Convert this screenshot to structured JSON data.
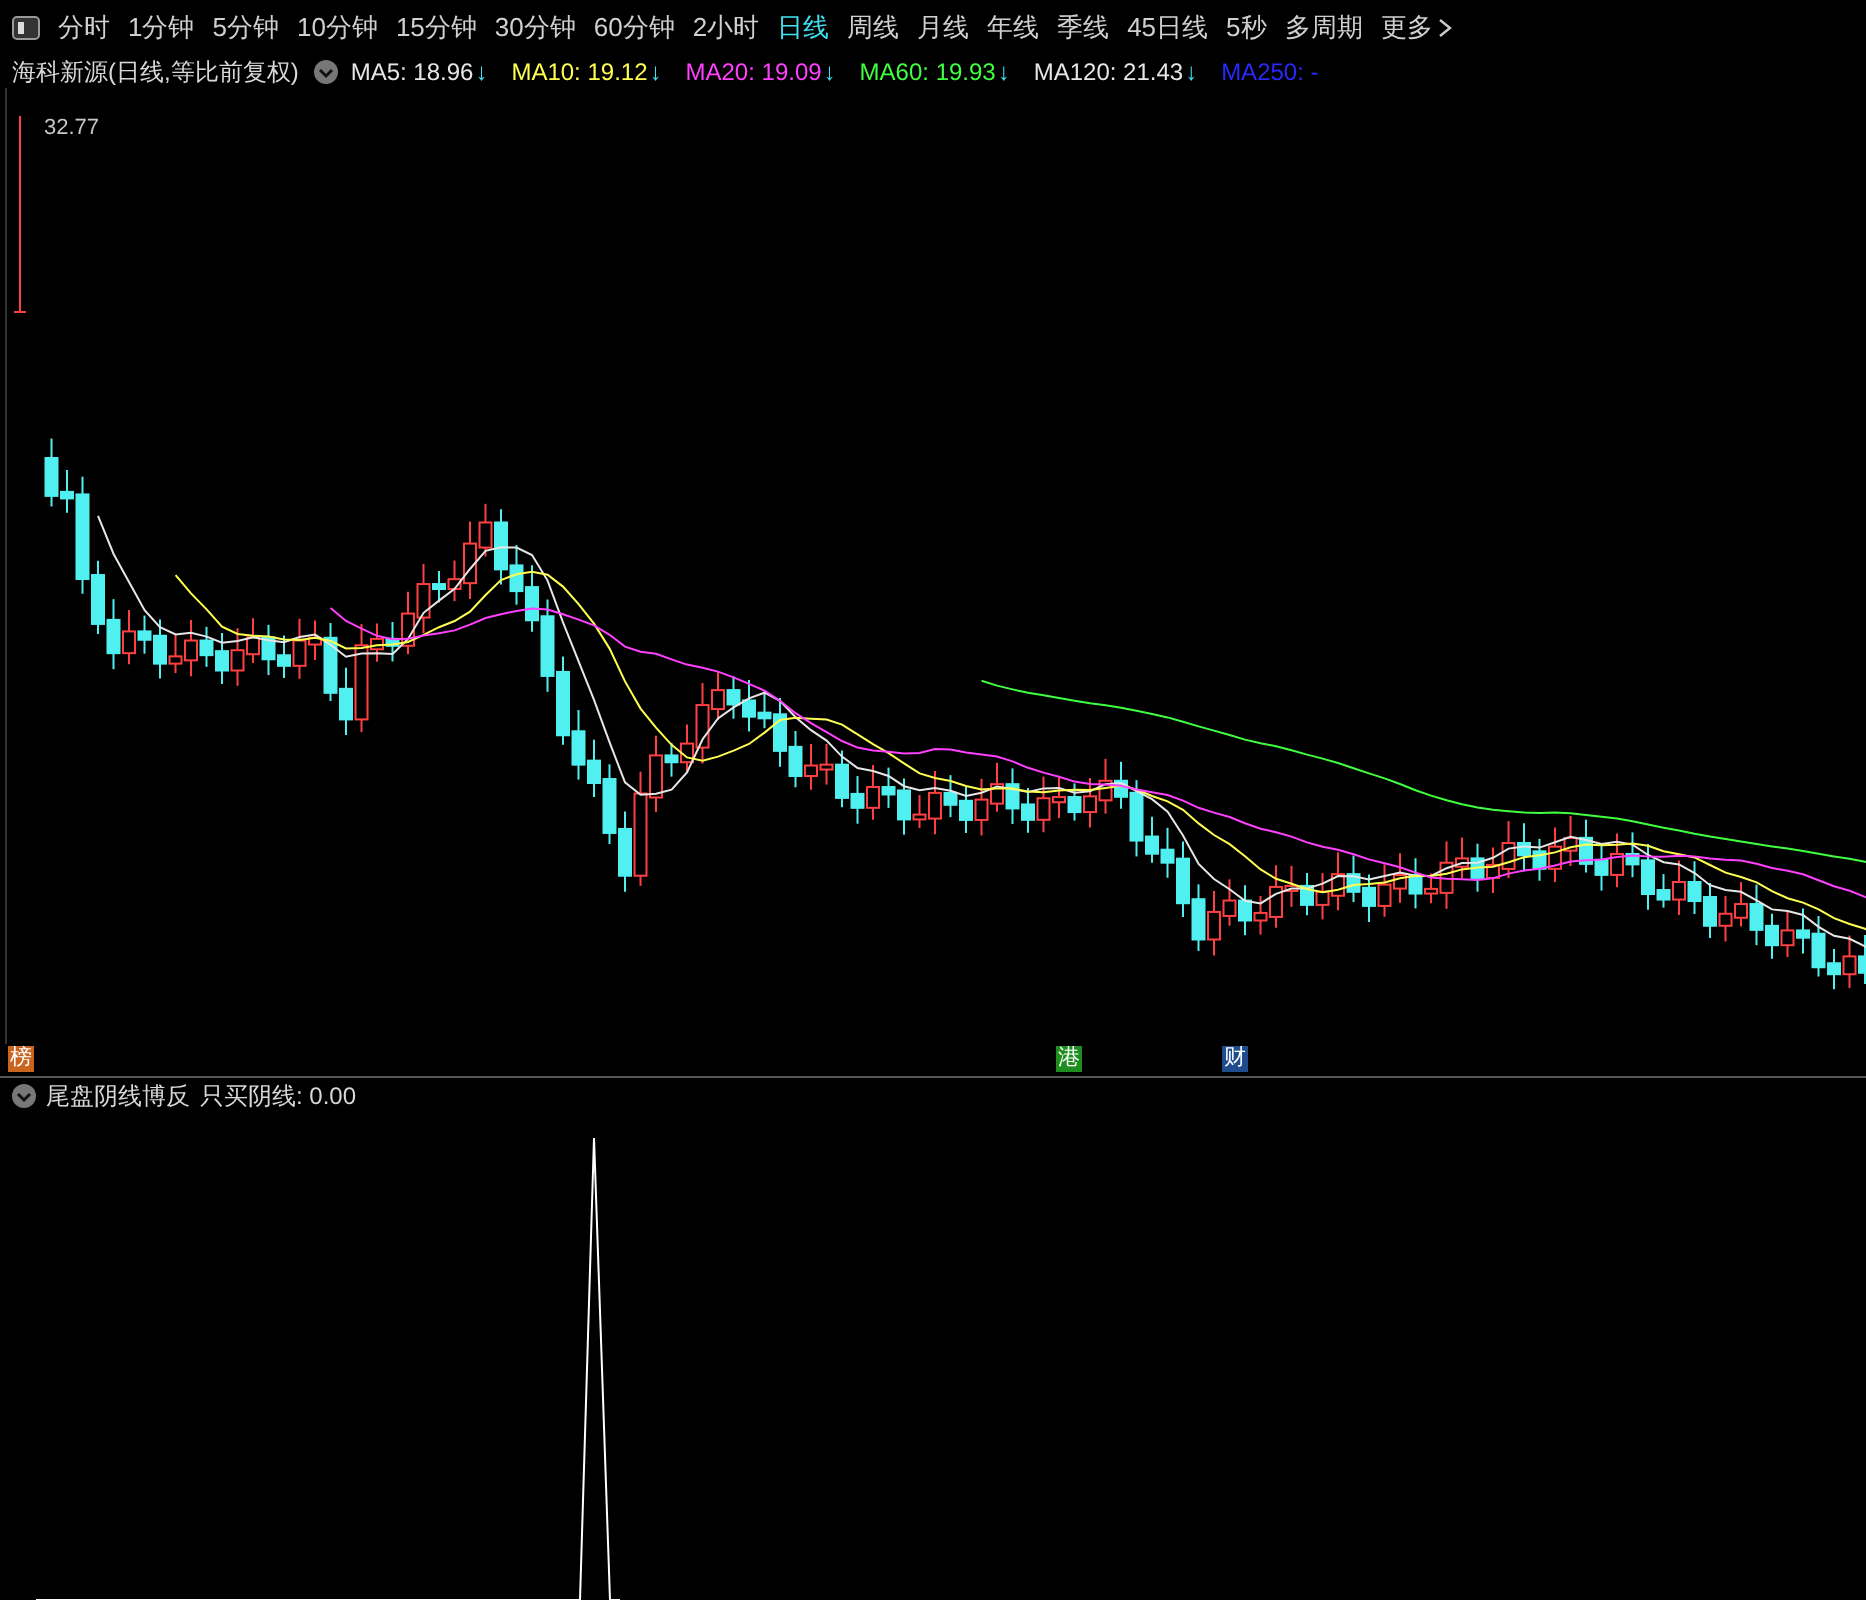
{
  "toolbar": {
    "tabs": [
      {
        "label": "分时",
        "selected": false
      },
      {
        "label": "1分钟",
        "selected": false
      },
      {
        "label": "5分钟",
        "selected": false
      },
      {
        "label": "10分钟",
        "selected": false
      },
      {
        "label": "15分钟",
        "selected": false
      },
      {
        "label": "30分钟",
        "selected": false
      },
      {
        "label": "60分钟",
        "selected": false
      },
      {
        "label": "2小时",
        "selected": false
      },
      {
        "label": "日线",
        "selected": true
      },
      {
        "label": "周线",
        "selected": false
      },
      {
        "label": "月线",
        "selected": false
      },
      {
        "label": "年线",
        "selected": false
      },
      {
        "label": "季线",
        "selected": false
      },
      {
        "label": "45日线",
        "selected": false
      },
      {
        "label": "5秒",
        "selected": false
      },
      {
        "label": "多周期",
        "selected": false
      },
      {
        "label": "更多",
        "selected": false
      }
    ]
  },
  "main_chart": {
    "title": "海科新源(日线,等比前复权)",
    "moving_averages": [
      {
        "label": "MA5: 18.96",
        "arrow": "↓",
        "color": "#e6e6e6"
      },
      {
        "label": "MA10: 19.12",
        "arrow": "↓",
        "color": "#ffff50"
      },
      {
        "label": "MA20: 19.09",
        "arrow": "↓",
        "color": "#ff40ff"
      },
      {
        "label": "MA60: 19.93",
        "arrow": "↓",
        "color": "#40ff40"
      },
      {
        "label": "MA120: 21.43",
        "arrow": "↓",
        "color": "#e6e6e6"
      },
      {
        "label": "MA250: -",
        "color": "#2828ff"
      }
    ],
    "high_label": "32.77",
    "event_markers": [
      {
        "label": "榜",
        "color": "#c8641e"
      },
      {
        "label": "港",
        "color": "#1e8c1e"
      },
      {
        "label": "财",
        "color": "#1e4c8c"
      }
    ]
  },
  "indicator": {
    "name": "尾盘阴线博反",
    "reading": "只买阴线: 0.00"
  }
}
